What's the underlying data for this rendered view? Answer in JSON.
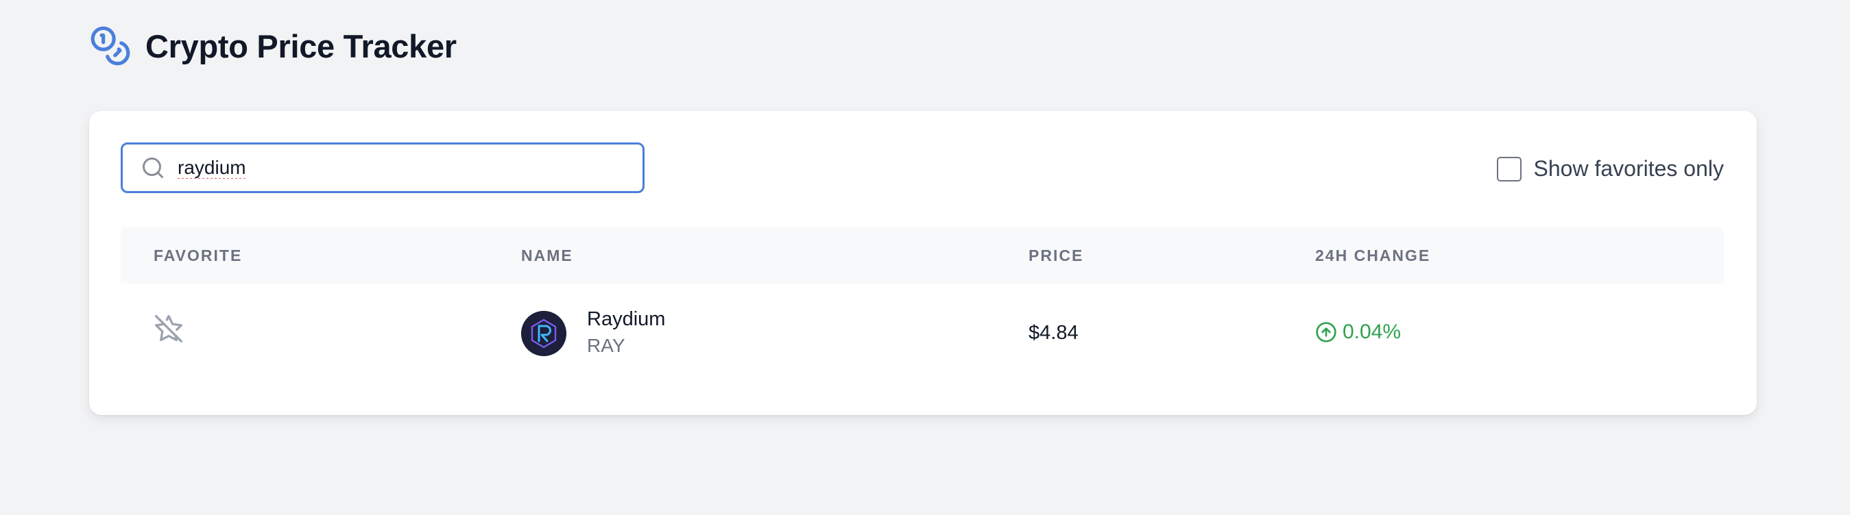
{
  "app": {
    "title": "Crypto Price Tracker",
    "icon": "coins-icon",
    "accent_color": "#4a7fdc"
  },
  "search": {
    "value": "raydium",
    "placeholder": "",
    "icon": "search-icon"
  },
  "filter": {
    "favorites_only_label": "Show favorites only",
    "favorites_only_checked": false
  },
  "table": {
    "columns": [
      "FAVORITE",
      "NAME",
      "PRICE",
      "24H CHANGE"
    ],
    "rows": [
      {
        "favorite": false,
        "favorite_icon": "star-off-icon",
        "logo_icon": "raydium-logo",
        "name": "Raydium",
        "symbol": "RAY",
        "price": "$4.84",
        "change": "0.04%",
        "change_direction": "up",
        "change_color": "#30a14e"
      }
    ]
  }
}
